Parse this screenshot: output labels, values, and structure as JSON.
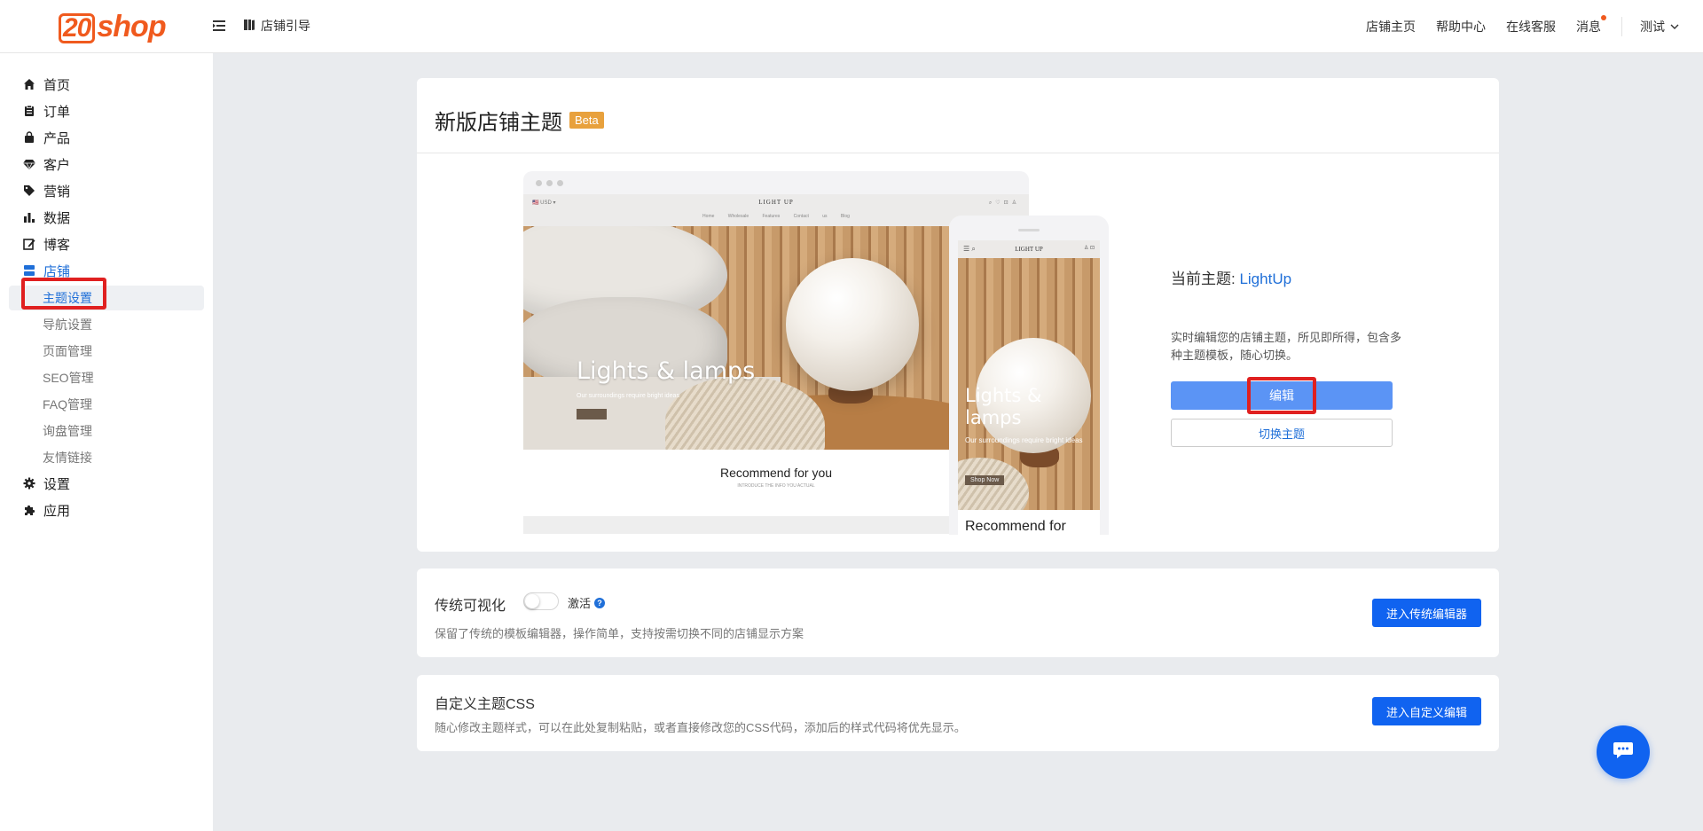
{
  "header": {
    "logo_text": "shop",
    "logo_prefix": "20",
    "guide_label": "店铺引导",
    "nav": {
      "store_home": "店铺主页",
      "help_center": "帮助中心",
      "online_service": "在线客服",
      "messages": "消息"
    },
    "user_name": "测试"
  },
  "sidebar": {
    "items": [
      {
        "label": "首页",
        "icon": "home-icon"
      },
      {
        "label": "订单",
        "icon": "order-icon"
      },
      {
        "label": "产品",
        "icon": "bag-icon"
      },
      {
        "label": "客户",
        "icon": "diamond-icon"
      },
      {
        "label": "营销",
        "icon": "tag-icon"
      },
      {
        "label": "数据",
        "icon": "bar-chart-icon"
      },
      {
        "label": "博客",
        "icon": "edit-icon"
      },
      {
        "label": "店铺",
        "icon": "store-icon"
      }
    ],
    "sub_items": [
      {
        "label": "主题设置"
      },
      {
        "label": "导航设置"
      },
      {
        "label": "页面管理"
      },
      {
        "label": "SEO管理"
      },
      {
        "label": "FAQ管理"
      },
      {
        "label": "询盘管理"
      },
      {
        "label": "友情链接"
      }
    ],
    "bottom_items": [
      {
        "label": "设置",
        "icon": "gear-icon"
      },
      {
        "label": "应用",
        "icon": "puzzle-icon"
      }
    ]
  },
  "theme_card": {
    "title": "新版店铺主题",
    "badge": "Beta",
    "current_theme_label": "当前主题: ",
    "current_theme_name": "LightUp",
    "description": "实时编辑您的店铺主题，所见即所得，包含多种主题模板，随心切换。",
    "edit_button": "编辑",
    "switch_button": "切换主题",
    "preview": {
      "site_logo": "LIGHT UP",
      "site_menu": "Home Wholesale Features Contact us Blog",
      "currency": "🇺🇸 USD ▾",
      "hero_title": "Lights & lamps",
      "hero_subtitle": "Our surroundings require bright ideas",
      "recommend_title": "Recommend for you",
      "recommend_subtitle": "INTRODUCE THE INFO YOU ACTUAL",
      "mobile_hero_title": "Lights & lamps",
      "mobile_hero_subtitle": "Our surroundings require bright ideas",
      "mobile_shop_button": "Shop Now",
      "mobile_recommend": "Recommend for"
    }
  },
  "legacy_card": {
    "title": "传统可视化",
    "activate_label": "激活",
    "toggle_on": false,
    "description": "保留了传统的模板编辑器，操作简单，支持按需切换不同的店铺显示方案",
    "button": "进入传统编辑器"
  },
  "css_card": {
    "title": "自定义主题CSS",
    "description": "随心修改主题样式，可以在此处复制粘贴，或者直接修改您的CSS代码，添加后的样式代码将优先显示。",
    "button": "进入自定义编辑"
  },
  "colors": {
    "brand_orange": "#f05a1e",
    "primary_blue": "#1063f0",
    "link_blue": "#1f6fd8",
    "beta_badge": "#e8a13d",
    "highlight_red": "#e02020"
  }
}
